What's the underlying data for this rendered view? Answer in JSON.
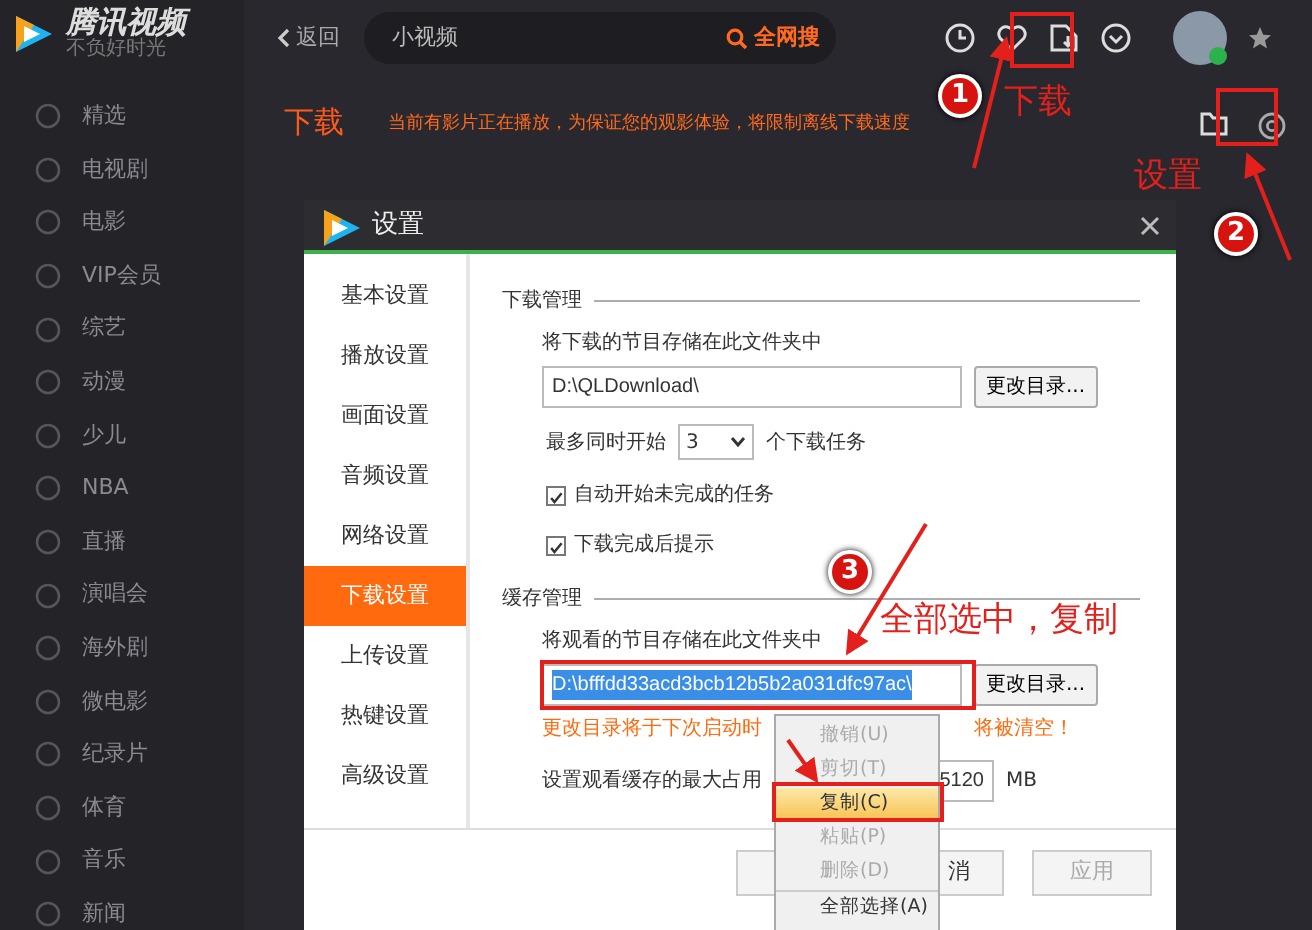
{
  "app": {
    "logo_text": "腾讯视频",
    "logo_tagline": "不负好时光"
  },
  "sidebar": {
    "items": [
      {
        "label": "精选"
      },
      {
        "label": "电视剧"
      },
      {
        "label": "电影"
      },
      {
        "label": "VIP会员"
      },
      {
        "label": "综艺"
      },
      {
        "label": "动漫"
      },
      {
        "label": "少儿"
      },
      {
        "label": "NBA"
      },
      {
        "label": "直播"
      },
      {
        "label": "演唱会"
      },
      {
        "label": "海外剧"
      },
      {
        "label": "微电影"
      },
      {
        "label": "纪录片"
      },
      {
        "label": "体育"
      },
      {
        "label": "音乐"
      },
      {
        "label": "新闻"
      }
    ]
  },
  "toolbar": {
    "back": "返回",
    "search": {
      "value": "小视频",
      "button": "全网搜"
    }
  },
  "page": {
    "title": "下载",
    "notice": "当前有影片正在播放，为保证您的观影体验，将限制离线下载速度"
  },
  "dialog": {
    "title": "设置",
    "nav": [
      {
        "label": "基本设置",
        "selected": false
      },
      {
        "label": "播放设置",
        "selected": false
      },
      {
        "label": "画面设置",
        "selected": false
      },
      {
        "label": "音频设置",
        "selected": false
      },
      {
        "label": "网络设置",
        "selected": false
      },
      {
        "label": "下载设置",
        "selected": true
      },
      {
        "label": "上传设置",
        "selected": false
      },
      {
        "label": "热键设置",
        "selected": false
      },
      {
        "label": "高级设置",
        "selected": false
      }
    ],
    "download": {
      "heading": "下载管理",
      "folder_label": "将下载的节目存储在此文件夹中",
      "folder": "D:\\QLDownload\\",
      "change_button": "更改目录...",
      "max_prefix": "最多同时开始",
      "max_value": "3",
      "max_suffix": "个下载任务",
      "options": [
        {
          "label": "自动开始未完成的任务",
          "checked": true
        },
        {
          "label": "下载完成后提示",
          "checked": true
        }
      ]
    },
    "cache": {
      "heading": "缓存管理",
      "folder_label": "将观看的节目存储在此文件夹中",
      "folder": "D:\\bfffdd33acd3bcb12b5b2a031dfc97ac\\",
      "change_button": "更改目录...",
      "warning_start": "更改目录将于下次启动时",
      "warning_end": "将被清空！",
      "limit_label": "设置观看缓存的最大占用",
      "limit_value": "5120",
      "limit_unit": "MB"
    },
    "buttons": [
      {
        "label": "消"
      },
      {
        "label": "应用"
      }
    ],
    "context_menu": {
      "items": [
        {
          "label": "撤销(U)",
          "disabled": true,
          "selected": false
        },
        {
          "label": "剪切(T)",
          "disabled": true,
          "selected": false
        },
        {
          "label": "复制(C)",
          "disabled": false,
          "selected": true
        },
        {
          "label": "粘贴(P)",
          "disabled": true,
          "selected": false
        },
        {
          "label": "删除(D)",
          "disabled": true,
          "selected": false
        },
        {
          "label": "全部选择(A)",
          "disabled": false,
          "selected": false
        }
      ]
    }
  },
  "annotations": [
    {
      "kind": "step",
      "text": "1"
    },
    {
      "kind": "label",
      "text": "下载"
    },
    {
      "kind": "label",
      "text": "设置"
    },
    {
      "kind": "step",
      "text": "2"
    },
    {
      "kind": "step",
      "text": "3"
    },
    {
      "kind": "label",
      "text": "全部选中，复制"
    }
  ]
}
